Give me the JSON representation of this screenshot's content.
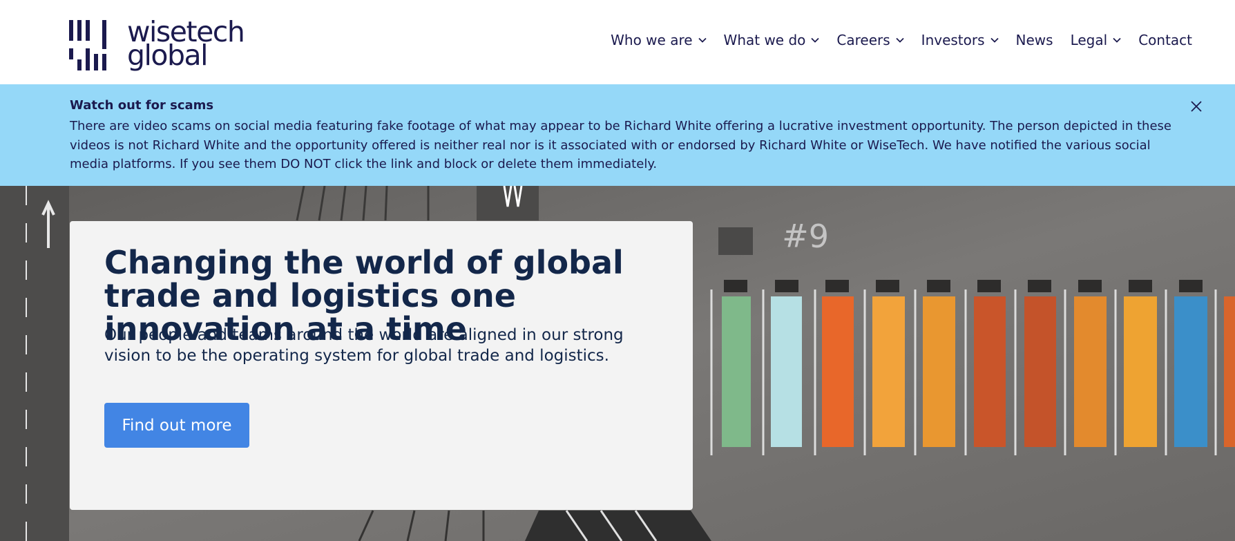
{
  "header": {
    "logo_line1": "wisetech",
    "logo_line2": "global",
    "nav": [
      {
        "label": "Who we are",
        "has_dropdown": true
      },
      {
        "label": "What we do",
        "has_dropdown": true
      },
      {
        "label": "Careers",
        "has_dropdown": true
      },
      {
        "label": "Investors",
        "has_dropdown": true
      },
      {
        "label": "News",
        "has_dropdown": false
      },
      {
        "label": "Legal",
        "has_dropdown": true
      },
      {
        "label": "Contact",
        "has_dropdown": false
      }
    ]
  },
  "alert": {
    "title": "Watch out for scams",
    "body": "There are video scams on social media featuring fake footage of what may appear to be Richard White offering a lucrative investment opportunity. The person depicted in these videos is not Richard White and the opportunity offered is neither real nor is it associated with or endorsed by Richard White or WiseTech. We have notified the various social media platforms. If you see them DO NOT click the link and block or delete them immediately.",
    "close_icon": "close-icon",
    "background": "#95d8f8"
  },
  "hero": {
    "title": "Changing the world of global trade and logistics one innovation at a time",
    "subtitle": "Our people and teams around the world are aligned in our strong vision to be the operating system for global trade and logistics.",
    "button_label": "Find out more",
    "button_color": "#4285e4",
    "container_colors": [
      "#7fb98a",
      "#b6e0e4",
      "#e8672a",
      "#f2a33b",
      "#e99730",
      "#c9552a",
      "#c4532a",
      "#e38a2d",
      "#eea332",
      "#3b8fc9"
    ]
  },
  "colors": {
    "brand": "#1b1a4e",
    "heading": "#13274a",
    "accent": "#4285e4"
  }
}
